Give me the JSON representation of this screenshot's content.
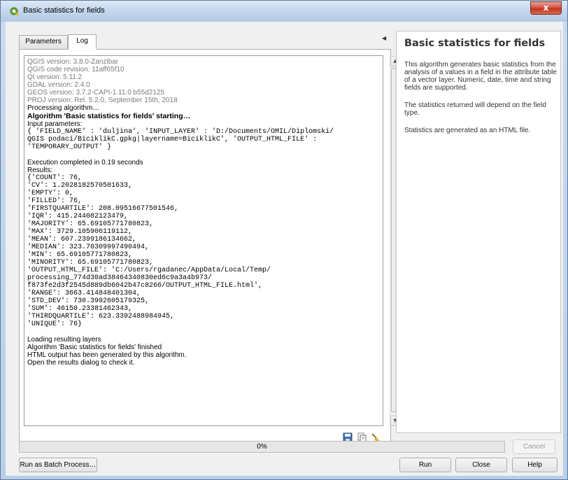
{
  "window": {
    "title": "Basic statistics for fields",
    "close_label": "x"
  },
  "tabs": [
    {
      "label": "Parameters"
    },
    {
      "label": "Log"
    }
  ],
  "log": {
    "versions": [
      "QGIS version: 3.8.0-Zanzibar",
      "QGIS code revision: 11aff65f10",
      "Qt version: 5.11.2",
      "GDAL version: 2.4.0",
      "GEOS version: 3.7.2-CAPI-1.11.0 b55d2125",
      "PROJ version: Rel. 5.2.0, September 15th, 2018"
    ],
    "processing": "Processing algorithm…",
    "starting": "Algorithm 'Basic statistics for fields' starting…",
    "input_params_label": "Input parameters:",
    "params": [
      "{ 'FIELD_NAME' : 'duljina', 'INPUT_LAYER' : 'D:/Documents/OMIL/Diplomski/",
      "QGIS podaci/BiciklikC.gpkg|layername=BiciklikC', 'OUTPUT_HTML_FILE' :",
      "'TEMPORARY_OUTPUT' }"
    ],
    "execution": "Execution completed in 0.19 seconds",
    "results_label": "Results:",
    "results": [
      "{'COUNT': 76,",
      "'CV': 1.2028182570501633,",
      "'EMPTY': 0,",
      "'FILLED': 76,",
      "'FIRSTQUARTILE': 208.09516677501546,",
      "'IQR': 415.244082123479,",
      "'MAJORITY': 65.69105771780823,",
      "'MAX': 3729.105906119112,",
      "'MEAN': 607.2399186134662,",
      "'MEDIAN': 323.70309997490494,",
      "'MIN': 65.69105771780823,",
      "'MINORITY': 65.69105771780823,",
      "'OUTPUT_HTML_FILE': 'C:/Users/rgadanec/AppData/Local/Temp/",
      "processing_774d30ad38464340830ed6c9a3a4b973/",
      "f873fe2d3f2545d889db6042b47c8266/OUTPUT_HTML_FILE.html',",
      "'RANGE': 3663.414848401304,",
      "'STD_DEV': 730.3992605179325,",
      "'SUM': 46150.23381462343,",
      "'THIRDQUARTILE': 623.3392488984945,",
      "'UNIQUE': 76}"
    ],
    "footer": [
      "Loading resulting layers",
      "Algorithm 'Basic statistics for fields' finished",
      "HTML output has been generated by this algorithm.",
      "Open the results dialog to check it."
    ]
  },
  "help": {
    "title": "Basic statistics for fields",
    "p1": "This algorithm generates basic statistics from the analysis of a values in a field in the attribute table of a vector layer. Numeric, date, time and string fields are supported.",
    "p2": "The statistics returned will depend on the field type.",
    "p3": "Statistics are generated as an HTML file."
  },
  "progress": {
    "label": "0%",
    "value": 0
  },
  "buttons": {
    "cancel": "Cancel",
    "batch": "Run as Batch Process…",
    "run": "Run",
    "close": "Close",
    "help": "Help"
  },
  "icons": {
    "title": "qgis-logo-icon",
    "save": "save-log-icon",
    "copy": "copy-log-icon",
    "clear": "clear-log-icon"
  }
}
